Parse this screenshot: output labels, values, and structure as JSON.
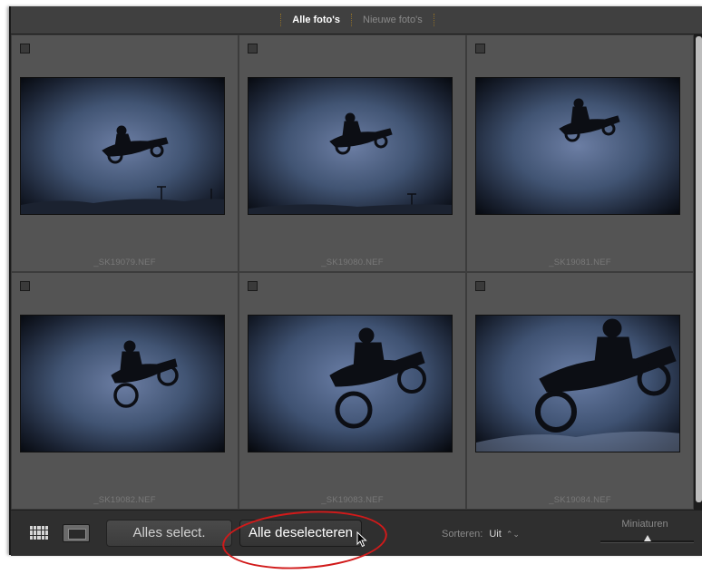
{
  "header": {
    "tabs": [
      {
        "label": "Alle foto's",
        "active": true
      },
      {
        "label": "Nieuwe foto's",
        "active": false
      }
    ]
  },
  "photos": [
    {
      "filename": "_SK19079.NEF"
    },
    {
      "filename": "_SK19080.NEF"
    },
    {
      "filename": "_SK19081.NEF"
    },
    {
      "filename": "_SK19082.NEF"
    },
    {
      "filename": "_SK19083.NEF"
    },
    {
      "filename": "_SK19084.NEF"
    }
  ],
  "toolbar": {
    "grid_view_icon": "grid-icon",
    "loupe_view_icon": "loupe-icon",
    "select_all_label": "Alles select.",
    "deselect_all_label": "Alle deselecteren",
    "sort_label": "Sorteren:",
    "sort_value": "Uit",
    "sort_arrows": "⌃⌄",
    "thumbnails_label": "Miniaturen",
    "thumbnail_size": 0.5
  },
  "colors": {
    "highlight_ring": "#d11a1a",
    "active_tab": "#ffffff",
    "inactive_tab": "#8a8a8a"
  }
}
